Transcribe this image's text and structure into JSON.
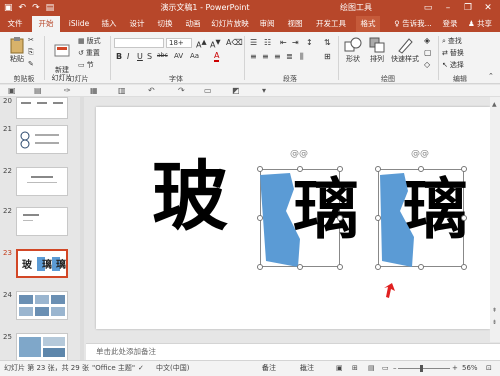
{
  "titlebar": {
    "doc_title": "演示文稿1 - PowerPoint",
    "contextual_title": "绘图工具",
    "qa_icons": [
      "save-icon",
      "undo-icon",
      "redo-icon",
      "present-icon"
    ],
    "window_controls": [
      "ribbon-display-icon",
      "minimize-icon",
      "restore-icon",
      "close-icon"
    ]
  },
  "tabs": [
    "文件",
    "开始",
    "iSlide",
    "插入",
    "设计",
    "切换",
    "动画",
    "幻灯片放映",
    "审阅",
    "视图",
    "开发工具",
    "格式"
  ],
  "tab_active": "开始",
  "tab_right": {
    "tell_me": "告诉我...",
    "login": "登录",
    "share": "共享"
  },
  "ribbon": {
    "clipboard": {
      "paste": "粘贴",
      "label": "剪贴板"
    },
    "slides": {
      "new_slide": "新建\n幻灯片",
      "layout": "版式",
      "reset": "重置",
      "section": "节",
      "label": "幻灯片"
    },
    "font": {
      "font_name": "",
      "font_size": "18+",
      "label": "字体",
      "buttons": [
        "B",
        "I",
        "U",
        "S",
        "abc",
        "AV",
        "Aa",
        "A"
      ]
    },
    "paragraph": {
      "label": "段落"
    },
    "drawing": {
      "shape": "形状",
      "arrange": "排列",
      "quick_styles": "快速样式",
      "label": "绘图"
    },
    "editing": {
      "find": "查找",
      "replace": "替换",
      "select": "选择",
      "label": "编辑"
    }
  },
  "thumbnails": [
    {
      "num": "20",
      "selected": false
    },
    {
      "num": "21",
      "selected": false
    },
    {
      "num": "22",
      "selected": false
    },
    {
      "num": "23",
      "selected": true,
      "chars": [
        "玻",
        "璃",
        "璃"
      ]
    },
    {
      "num": "24",
      "selected": false
    },
    {
      "num": "25",
      "selected": false
    }
  ],
  "slide": {
    "char_left": "玻",
    "char_mid": "璃",
    "char_right": "璃",
    "accent": "#5b9bd5"
  },
  "notes_placeholder": "单击此处添加备注",
  "statusbar": {
    "slide_info": "幻灯片 第 23 张，共 29 张",
    "theme": "\"Office 主题\"",
    "language": "中文(中国)",
    "notes": "备注",
    "comments": "批注",
    "zoom": "56%"
  },
  "colors": {
    "brand": "#b7472a",
    "ribbon_bg": "#f3f3f3",
    "selection": "#d24726"
  }
}
